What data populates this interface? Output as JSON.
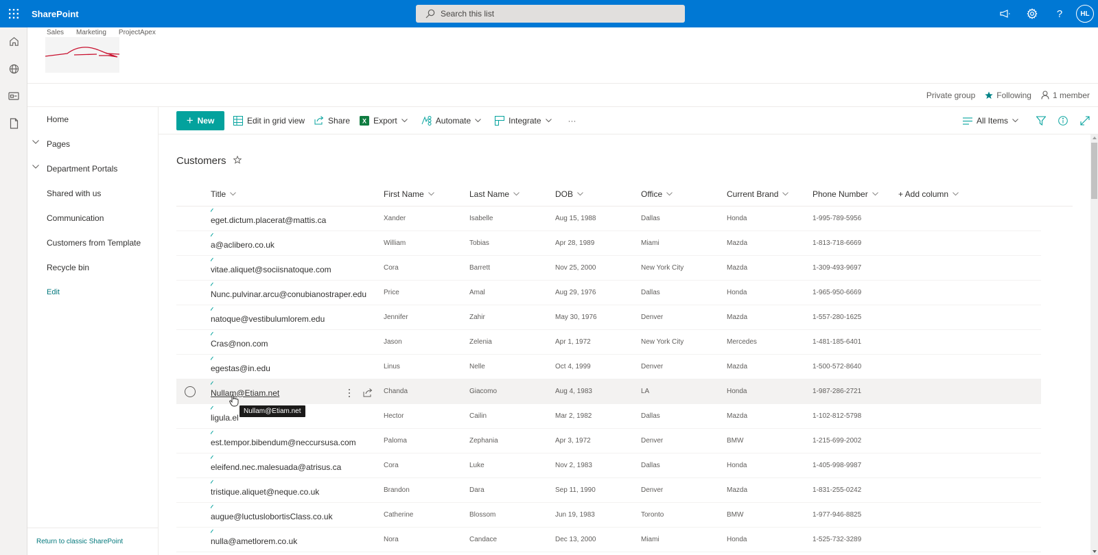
{
  "suite": {
    "app_name": "SharePoint",
    "search_placeholder": "Search this list",
    "avatar_initials": "HL"
  },
  "hub_nav": [
    "Sales",
    "Marketing",
    "ProjectApex"
  ],
  "site_meta": {
    "privacy": "Private group",
    "following": "Following",
    "members": "1 member"
  },
  "left_nav": {
    "items": [
      {
        "label": "Home",
        "expandable": false
      },
      {
        "label": "Pages",
        "expandable": true
      },
      {
        "label": "Department Portals",
        "expandable": true
      },
      {
        "label": "Shared with us",
        "expandable": false
      },
      {
        "label": "Communication",
        "expandable": false
      },
      {
        "label": "Customers from Template",
        "expandable": false
      },
      {
        "label": "Recycle bin",
        "expandable": false
      }
    ],
    "edit_label": "Edit",
    "classic_link": "Return to classic SharePoint"
  },
  "command_bar": {
    "new_label": "New",
    "edit_grid_label": "Edit in grid view",
    "share_label": "Share",
    "export_label": "Export",
    "automate_label": "Automate",
    "integrate_label": "Integrate",
    "more_label": "···",
    "view_label": "All Items"
  },
  "list": {
    "title": "Customers",
    "columns": [
      "Title",
      "First Name",
      "Last Name",
      "DOB",
      "Office",
      "Current Brand",
      "Phone Number"
    ],
    "add_column_label": "+ Add column",
    "rows": [
      {
        "title": "eget.dictum.placerat@mattis.ca",
        "first": "Xander",
        "last": "Isabelle",
        "dob": "Aug 15, 1988",
        "office": "Dallas",
        "brand": "Honda",
        "phone": "1-995-789-5956"
      },
      {
        "title": "a@aclibero.co.uk",
        "first": "William",
        "last": "Tobias",
        "dob": "Apr 28, 1989",
        "office": "Miami",
        "brand": "Mazda",
        "phone": "1-813-718-6669"
      },
      {
        "title": "vitae.aliquet@sociisnatoque.com",
        "first": "Cora",
        "last": "Barrett",
        "dob": "Nov 25, 2000",
        "office": "New York City",
        "brand": "Mazda",
        "phone": "1-309-493-9697"
      },
      {
        "title": "Nunc.pulvinar.arcu@conubianostraper.edu",
        "first": "Price",
        "last": "Amal",
        "dob": "Aug 29, 1976",
        "office": "Dallas",
        "brand": "Honda",
        "phone": "1-965-950-6669"
      },
      {
        "title": "natoque@vestibulumlorem.edu",
        "first": "Jennifer",
        "last": "Zahir",
        "dob": "May 30, 1976",
        "office": "Denver",
        "brand": "Mazda",
        "phone": "1-557-280-1625"
      },
      {
        "title": "Cras@non.com",
        "first": "Jason",
        "last": "Zelenia",
        "dob": "Apr 1, 1972",
        "office": "New York City",
        "brand": "Mercedes",
        "phone": "1-481-185-6401"
      },
      {
        "title": "egestas@in.edu",
        "first": "Linus",
        "last": "Nelle",
        "dob": "Oct 4, 1999",
        "office": "Denver",
        "brand": "Mazda",
        "phone": "1-500-572-8640"
      },
      {
        "title": "Nullam@Etiam.net",
        "first": "Chanda",
        "last": "Giacomo",
        "dob": "Aug 4, 1983",
        "office": "LA",
        "brand": "Honda",
        "phone": "1-987-286-2721",
        "hovered": true
      },
      {
        "title": "ligula.el",
        "first": "Hector",
        "last": "Cailin",
        "dob": "Mar 2, 1982",
        "office": "Dallas",
        "brand": "Mazda",
        "phone": "1-102-812-5798"
      },
      {
        "title": "est.tempor.bibendum@neccursusa.com",
        "first": "Paloma",
        "last": "Zephania",
        "dob": "Apr 3, 1972",
        "office": "Denver",
        "brand": "BMW",
        "phone": "1-215-699-2002"
      },
      {
        "title": "eleifend.nec.malesuada@atrisus.ca",
        "first": "Cora",
        "last": "Luke",
        "dob": "Nov 2, 1983",
        "office": "Dallas",
        "brand": "Honda",
        "phone": "1-405-998-9987"
      },
      {
        "title": "tristique.aliquet@neque.co.uk",
        "first": "Brandon",
        "last": "Dara",
        "dob": "Sep 11, 1990",
        "office": "Denver",
        "brand": "Mazda",
        "phone": "1-831-255-0242"
      },
      {
        "title": "augue@luctuslobortisClass.co.uk",
        "first": "Catherine",
        "last": "Blossom",
        "dob": "Jun 19, 1983",
        "office": "Toronto",
        "brand": "BMW",
        "phone": "1-977-946-8825"
      },
      {
        "title": "nulla@ametlorem.co.uk",
        "first": "Nora",
        "last": "Candace",
        "dob": "Dec 13, 2000",
        "office": "Miami",
        "brand": "Honda",
        "phone": "1-525-732-3289"
      }
    ]
  },
  "tooltip": {
    "text": "Nullam@Etiam.net"
  },
  "colors": {
    "suite_bar": "#0078d4",
    "accent": "#03a29d",
    "link_teal": "#03787c"
  }
}
